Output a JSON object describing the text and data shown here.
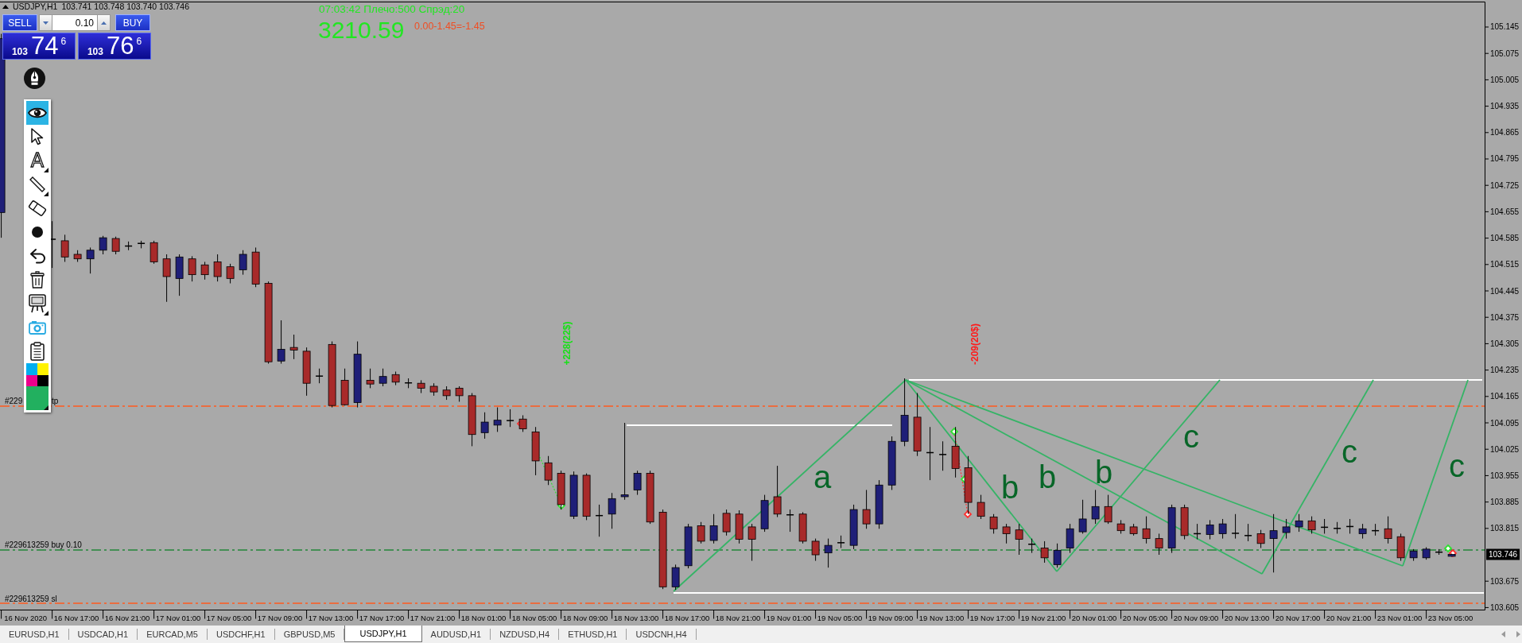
{
  "chart": {
    "symbol": "USDJPY,H1",
    "quote": "103.741 103.748 103.740 103.746",
    "current_price": "103.746",
    "chart_data": {
      "type": "candlestick",
      "ylim": [
        103.5985,
        105.2114
      ],
      "yticks": [
        105.145,
        105.075,
        105.005,
        104.935,
        104.865,
        104.795,
        104.725,
        104.655,
        104.585,
        104.515,
        104.445,
        104.375,
        104.305,
        104.235,
        104.165,
        104.095,
        104.025,
        103.955,
        103.885,
        103.815,
        103.675,
        103.605
      ],
      "categories": [
        null,
        null,
        "16 Nov 2020",
        null,
        null,
        null,
        "16 Nov 17:00",
        null,
        null,
        null,
        "16 Nov 21:00",
        null,
        null,
        null,
        "17 Nov 01:00",
        null,
        null,
        null,
        "17 Nov 05:00",
        null,
        null,
        null,
        "17 Nov 09:00",
        null,
        null,
        null,
        "17 Nov 13:00",
        null,
        null,
        null,
        "17 Nov 17:00",
        null,
        null,
        null,
        "17 Nov 21:00",
        null,
        null,
        null,
        "18 Nov 01:00",
        null,
        null,
        null,
        "18 Nov 05:00",
        null,
        null,
        null,
        "18 Nov 09:00",
        null,
        null,
        null,
        "18 Nov 13:00",
        null,
        null,
        null,
        "18 Nov 17:00",
        null,
        null,
        null,
        "18 Nov 21:00",
        null,
        null,
        null,
        "19 Nov 01:00",
        null,
        null,
        null,
        "19 Nov 05:00",
        null,
        null,
        null,
        "19 Nov 09:00",
        null,
        null,
        null,
        "19 Nov 13:00",
        null,
        null,
        null,
        "19 Nov 17:00",
        null,
        null,
        null,
        "19 Nov 21:00",
        null,
        null,
        null,
        "20 Nov 01:00",
        null,
        null,
        null,
        "20 Nov 05:00",
        null,
        null,
        null,
        "20 Nov 09:00",
        null,
        null,
        null,
        "20 Nov 13:00",
        null,
        null,
        null,
        "20 Nov 17:00",
        null,
        null,
        null,
        "20 Nov 21:00",
        null,
        null,
        null,
        "23 Nov 01:00",
        null,
        null,
        null,
        "23 Nov 05:00"
      ],
      "ohlc": [
        [
          104.653,
          105.127,
          104.586,
          105.114
        ],
        null,
        null,
        null,
        [
          104.582,
          104.63,
          104.506,
          104.582
        ],
        [
          104.578,
          104.594,
          104.522,
          104.535
        ],
        [
          104.542,
          104.553,
          104.522,
          104.53
        ],
        [
          104.53,
          104.56,
          104.491,
          104.553
        ],
        [
          104.553,
          104.591,
          104.542,
          104.586
        ],
        [
          104.584,
          104.589,
          104.542,
          104.55
        ],
        [
          104.564,
          104.576,
          104.553,
          104.564
        ],
        [
          104.571,
          104.578,
          104.558,
          104.571
        ],
        [
          104.573,
          104.578,
          104.517,
          104.522
        ],
        [
          104.53,
          104.542,
          104.416,
          104.483
        ],
        [
          104.478,
          104.542,
          104.432,
          104.535
        ],
        [
          104.53,
          104.537,
          104.47,
          104.488
        ],
        [
          104.514,
          104.522,
          104.475,
          104.488
        ],
        [
          104.522,
          104.542,
          104.47,
          104.483
        ],
        [
          104.509,
          104.517,
          104.465,
          104.478
        ],
        [
          104.501,
          104.553,
          104.488,
          104.542
        ],
        [
          104.548,
          104.56,
          104.455,
          104.463
        ],
        [
          104.465,
          104.47,
          104.252,
          104.257
        ],
        [
          104.259,
          104.367,
          104.252,
          104.29
        ],
        [
          104.295,
          104.329,
          104.264,
          104.288
        ],
        [
          104.285,
          104.295,
          104.167,
          104.2
        ],
        [
          104.219,
          104.239,
          104.2,
          104.219
        ],
        [
          104.303,
          104.311,
          104.136,
          104.141
        ],
        [
          104.208,
          104.239,
          104.141,
          104.143
        ],
        [
          104.149,
          104.311,
          104.136,
          104.277
        ],
        [
          104.208,
          104.239,
          104.187,
          104.198
        ],
        [
          104.2,
          104.239,
          104.192,
          104.218
        ],
        [
          104.223,
          104.231,
          104.195,
          104.203
        ],
        [
          104.201,
          104.213,
          104.187,
          104.201
        ],
        [
          104.2,
          104.208,
          104.174,
          104.187
        ],
        [
          104.192,
          104.2,
          104.167,
          104.177
        ],
        [
          104.182,
          104.192,
          104.156,
          104.167
        ],
        [
          104.187,
          104.192,
          104.151,
          104.167
        ],
        [
          104.167,
          104.174,
          104.033,
          104.064
        ],
        [
          104.069,
          104.123,
          104.053,
          104.097
        ],
        [
          104.089,
          104.136,
          104.071,
          104.102
        ],
        [
          104.101,
          104.131,
          104.084,
          104.101
        ],
        [
          104.105,
          104.115,
          104.071,
          104.079
        ],
        [
          104.071,
          104.084,
          103.956,
          103.994
        ],
        [
          103.989,
          104.007,
          103.93,
          103.943
        ],
        [
          103.961,
          103.968,
          103.865,
          103.878
        ],
        [
          103.847,
          103.966,
          103.84,
          103.956
        ],
        [
          103.956,
          103.961,
          103.837,
          103.847
        ],
        [
          103.849,
          103.878,
          103.793,
          103.849
        ],
        [
          103.853,
          103.909,
          103.814,
          103.894
        ],
        [
          103.899,
          104.095,
          103.891,
          103.904
        ],
        [
          103.917,
          103.968,
          103.904,
          103.961
        ],
        [
          103.961,
          103.968,
          103.827,
          103.832
        ],
        [
          103.858,
          103.865,
          103.654,
          103.66
        ],
        [
          103.66,
          103.719,
          103.652,
          103.711
        ],
        [
          103.716,
          103.827,
          103.709,
          103.819
        ],
        [
          103.822,
          103.832,
          103.775,
          103.781
        ],
        [
          103.783,
          103.853,
          103.775,
          103.822
        ],
        [
          103.855,
          103.865,
          103.796,
          103.806
        ],
        [
          103.853,
          103.863,
          103.775,
          103.786
        ],
        [
          103.819,
          103.827,
          103.729,
          103.786
        ],
        [
          103.814,
          103.904,
          103.806,
          103.889
        ],
        [
          103.899,
          103.981,
          103.845,
          103.853
        ],
        [
          103.851,
          103.865,
          103.806,
          103.851
        ],
        [
          103.853,
          103.858,
          103.775,
          103.781
        ],
        [
          103.781,
          103.788,
          103.729,
          103.745
        ],
        [
          103.75,
          103.788,
          103.711,
          103.77
        ],
        [
          103.777,
          103.796,
          103.763,
          103.777
        ],
        [
          103.77,
          103.878,
          103.76,
          103.865
        ],
        [
          103.865,
          103.917,
          103.814,
          103.827
        ],
        [
          103.827,
          103.943,
          103.814,
          103.93
        ],
        [
          103.93,
          104.059,
          103.917,
          104.046
        ],
        [
          104.046,
          104.213,
          104.033,
          104.115
        ],
        [
          104.11,
          104.174,
          104.007,
          104.02
        ],
        [
          104.016,
          104.084,
          103.943,
          104.016
        ],
        [
          104.011,
          104.046,
          103.968,
          104.011
        ],
        [
          104.033,
          104.084,
          103.95,
          103.974
        ],
        [
          103.976,
          104.007,
          103.853,
          103.884
        ],
        [
          103.884,
          103.904,
          103.84,
          103.847
        ],
        [
          103.845,
          103.853,
          103.801,
          103.814
        ],
        [
          103.819,
          103.827,
          103.775,
          103.801
        ],
        [
          103.811,
          103.827,
          103.745,
          103.786
        ],
        [
          103.773,
          103.788,
          103.75,
          103.773
        ],
        [
          103.763,
          103.781,
          103.724,
          103.737
        ],
        [
          103.719,
          103.775,
          103.711,
          103.757
        ],
        [
          103.763,
          103.827,
          103.75,
          103.814
        ],
        [
          103.806,
          103.891,
          103.801,
          103.84
        ],
        [
          103.84,
          103.917,
          103.827,
          103.873
        ],
        [
          103.873,
          103.904,
          103.827,
          103.832
        ],
        [
          103.827,
          103.837,
          103.801,
          103.809
        ],
        [
          103.819,
          103.827,
          103.796,
          103.801
        ],
        [
          103.814,
          103.847,
          103.775,
          103.788
        ],
        [
          103.788,
          103.801,
          103.745,
          103.763
        ],
        [
          103.763,
          103.878,
          103.75,
          103.87
        ],
        [
          103.87,
          103.878,
          103.786,
          103.796
        ],
        [
          103.801,
          103.827,
          103.786,
          103.801
        ],
        [
          103.799,
          103.837,
          103.786,
          103.824
        ],
        [
          103.801,
          103.84,
          103.788,
          103.827
        ],
        [
          103.802,
          103.853,
          103.788,
          103.802
        ],
        [
          103.796,
          103.827,
          103.781,
          103.796
        ],
        [
          103.801,
          103.811,
          103.763,
          103.775
        ],
        [
          103.788,
          103.853,
          103.698,
          103.809
        ],
        [
          103.804,
          103.84,
          103.788,
          103.819
        ],
        [
          103.819,
          103.853,
          103.806,
          103.835
        ],
        [
          103.835,
          103.847,
          103.801,
          103.811
        ],
        [
          103.818,
          103.84,
          103.801,
          103.818
        ],
        [
          103.815,
          103.832,
          103.801,
          103.815
        ],
        [
          103.82,
          103.84,
          103.801,
          103.82
        ],
        [
          103.801,
          103.827,
          103.788,
          103.814
        ],
        [
          103.809,
          103.827,
          103.796,
          103.809
        ],
        [
          103.814,
          103.847,
          103.775,
          103.788
        ],
        [
          103.793,
          103.801,
          103.729,
          103.737
        ],
        [
          103.737,
          103.76,
          103.729,
          103.755
        ],
        [
          103.737,
          103.765,
          103.732,
          103.76
        ],
        [
          103.752,
          103.76,
          103.745,
          103.752
        ],
        [
          103.741,
          103.748,
          103.74,
          103.746
        ]
      ]
    }
  },
  "trade_panel": {
    "sell_label": "SELL",
    "buy_label": "BUY",
    "lot": "0.10",
    "sell_price": {
      "big": "103",
      "pips": "74",
      "point": "6"
    },
    "buy_price": {
      "big": "103",
      "pips": "76",
      "point": "6"
    }
  },
  "account": {
    "status": "07:03:42 Плечо:500 Спрэд:20",
    "balance": "3210.59",
    "profit": "0.00-1.45=-1.45"
  },
  "toolbar": {
    "tools": [
      {
        "kind": "eye",
        "selected": true,
        "submenu": false
      },
      {
        "kind": "cursor",
        "selected": false,
        "submenu": false
      },
      {
        "kind": "text",
        "glyph": "A",
        "selected": false,
        "submenu": true
      },
      {
        "kind": "line",
        "selected": false,
        "submenu": true
      },
      {
        "kind": "eraser",
        "selected": false,
        "submenu": false
      },
      {
        "kind": "dot",
        "selected": false,
        "submenu": false
      },
      {
        "kind": "undo",
        "selected": false,
        "submenu": false
      },
      {
        "kind": "trash",
        "selected": false,
        "submenu": false
      },
      {
        "kind": "easel",
        "selected": false,
        "submenu": true
      },
      {
        "kind": "camera",
        "selected": false,
        "submenu": false
      },
      {
        "kind": "clipboard",
        "selected": false,
        "submenu": false
      }
    ],
    "palette": [
      {
        "color": "#00aeef"
      },
      {
        "color": "#fff200"
      },
      {
        "color": "#ec008c"
      },
      {
        "color": "#000000"
      }
    ],
    "current_color": {
      "color": "#22b05f",
      "submenu": true
    }
  },
  "orders": [
    {
      "kind": "tp",
      "label": "#229",
      "label_tail": "tp"
    },
    {
      "kind": "buy",
      "label": "#229613259 buy 0.10"
    },
    {
      "kind": "sl",
      "label": "#229613259 sl"
    }
  ],
  "trade_results": [
    {
      "kind": "profit",
      "text": "+228(22$)"
    },
    {
      "kind": "loss",
      "text": "-209(20$)"
    }
  ],
  "pattern_labels": [
    "a",
    "b",
    "b",
    "b",
    "c",
    "c",
    "c"
  ],
  "tabs": [
    {
      "label": "EURUSD,H1",
      "selected": false
    },
    {
      "label": "USDCAD,H1",
      "selected": false
    },
    {
      "label": "EURCAD,M5",
      "selected": false
    },
    {
      "label": "USDCHF,H1",
      "selected": false
    },
    {
      "label": "GBPUSD,M5",
      "selected": false
    },
    {
      "label": "USDJPY,H1",
      "selected": true
    },
    {
      "label": "AUDUSD,H1",
      "selected": false
    },
    {
      "label": "NZDUSD,H4",
      "selected": false
    },
    {
      "label": "ETHUSD,H1",
      "selected": false
    },
    {
      "label": "USDCNH,H4",
      "selected": false
    }
  ]
}
